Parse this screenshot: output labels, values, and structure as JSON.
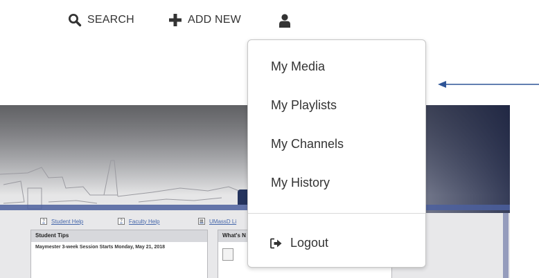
{
  "nav": {
    "search_label": "SEARCH",
    "add_new_label": "ADD NEW",
    "search_icon": "magnifier-icon",
    "add_icon": "plus-icon",
    "user_icon": "user-icon"
  },
  "menu": {
    "items": [
      {
        "label": "My Media"
      },
      {
        "label": "My Playlists"
      },
      {
        "label": "My Channels"
      },
      {
        "label": "My History"
      }
    ],
    "logout_label": "Logout",
    "logout_icon": "sign-out-icon"
  },
  "portal": {
    "student_help": "Student Help",
    "faculty_help": "Faculty Help",
    "umassd_link": "UMassD Li",
    "tips_title": "Student Tips",
    "tips_text": "Maymester 3-week Session Starts Monday, May 21, 2018",
    "whats_title": "What's N"
  },
  "colors": {
    "text": "#333333",
    "arrow": "#2f5597",
    "hero_navy": "#1e2a52"
  }
}
